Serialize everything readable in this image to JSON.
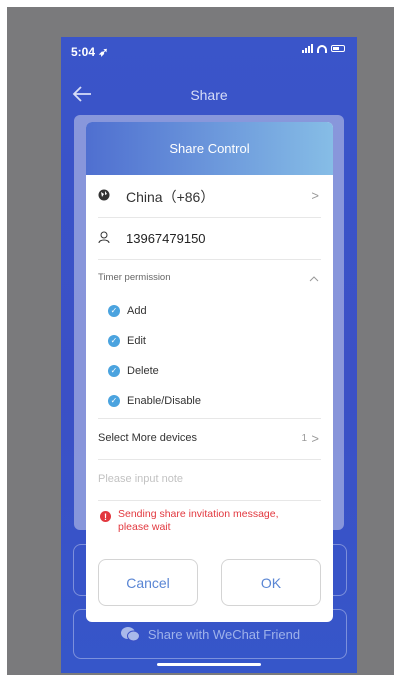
{
  "status_bar": {
    "time": "5:04"
  },
  "nav": {
    "title": "Share"
  },
  "dialog": {
    "title": "Share Control",
    "country": "China（+86）",
    "phone": "13967479150",
    "timer_permission_label": "Timer permission",
    "permissions": [
      "Add",
      "Edit",
      "Delete",
      "Enable/Disable"
    ],
    "select_devices_label": "Select More devices",
    "select_devices_count": "1",
    "note_placeholder": "Please input note",
    "error_message": "Sending share invitation message, please wait",
    "cancel_label": "Cancel",
    "ok_label": "OK"
  },
  "background": {
    "wechat_label": "Share with WeChat Friend"
  },
  "colors": {
    "accent": "#4aa3df",
    "error": "#e2383f",
    "header_start": "#4f6fd0",
    "header_end": "#86bde6"
  },
  "icons": [
    "location-arrow-icon",
    "globe-icon",
    "user-icon",
    "chevron-right-icon",
    "chevron-up-icon",
    "check-circle-icon",
    "error-icon",
    "wechat-icon",
    "back-arrow-icon"
  ]
}
